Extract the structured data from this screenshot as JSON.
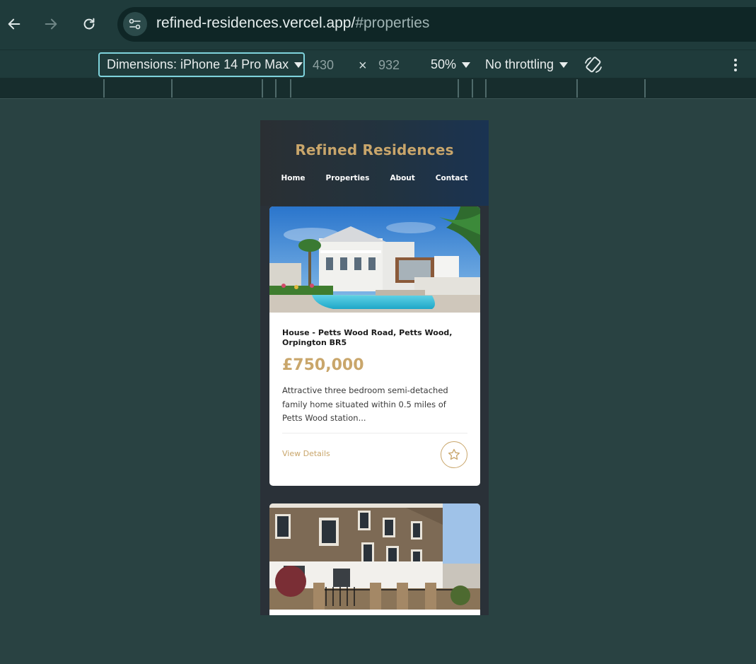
{
  "browser": {
    "url_host": "refined-residences.vercel.app/",
    "url_path": "#properties",
    "back_icon": "arrow-left-icon",
    "forward_icon": "arrow-right-icon",
    "reload_icon": "reload-icon",
    "site_info_icon": "tune-icon"
  },
  "devtools": {
    "dimensions_label": "Dimensions: iPhone 14 Pro Max",
    "width": "430",
    "times": "×",
    "height": "932",
    "zoom": "50%",
    "throttling": "No throttling",
    "rotate_icon": "rotate-icon",
    "menu_icon": "more-vert-icon"
  },
  "site": {
    "brand": "Refined Residences",
    "nav": [
      "Home",
      "Properties",
      "About",
      "Contact"
    ],
    "accent_color": "#c9a66b",
    "properties": [
      {
        "title": "House - Petts Wood Road, Petts Wood, Orpington BR5",
        "price": "£750,000",
        "description": "Attractive three bedroom semi-detached family home situated within 0.5 miles of Petts Wood station...",
        "cta": "View Details",
        "favorite_icon": "star-outline-icon"
      }
    ]
  }
}
